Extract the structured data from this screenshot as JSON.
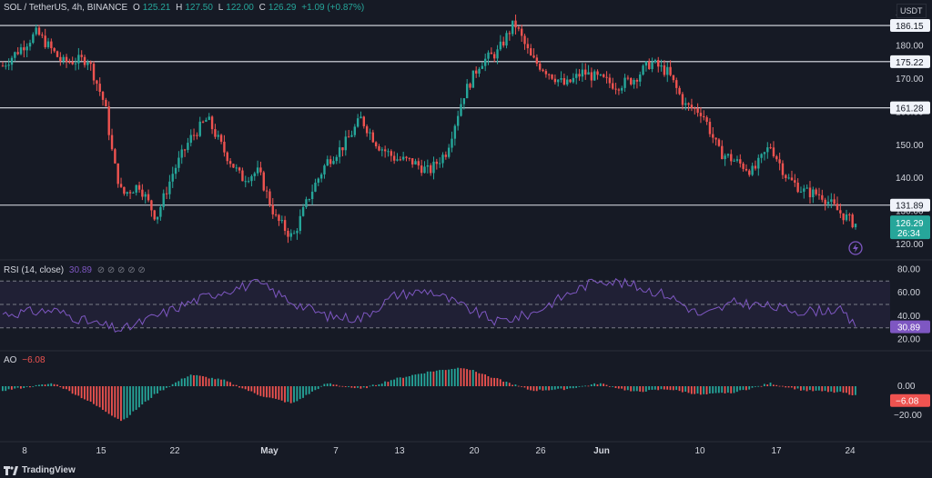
{
  "header": {
    "symbol": "SOL / TetherUS, 4h, BINANCE",
    "open_label": "O",
    "open": "125.21",
    "high_label": "H",
    "high": "127.50",
    "low_label": "L",
    "low": "122.00",
    "close_label": "C",
    "close": "126.29",
    "change": "+1.09 (+0.87%)"
  },
  "currency": "USDT",
  "rsi": {
    "title": "RSI (14, close)",
    "value": "30.89",
    "icons": "⊘ ⊘ ⊘ ⊘ ⊘"
  },
  "ao": {
    "title": "AO",
    "value": "−6.08"
  },
  "footer": {
    "brand": "TradingView"
  },
  "colors": {
    "up": "#26a69a",
    "down": "#ef5350",
    "rsi_line": "#7e57c2",
    "bg": "#161a25",
    "text": "#d1d4dc"
  },
  "chart_data": {
    "type": "candlestick",
    "price_axis_ticks": [
      "190.00",
      "180.00",
      "170.00",
      "160.00",
      "150.00",
      "140.00",
      "130.00",
      "120.00"
    ],
    "price_ylim": [
      117,
      190
    ],
    "horizontal_levels": [
      "186.15",
      "175.22",
      "161.28",
      "131.89"
    ],
    "current_price": "126.29",
    "countdown": "26:34",
    "x_ticks": [
      "8",
      "15",
      "22",
      "May",
      "7",
      "13",
      "20",
      "26",
      "Jun",
      "10",
      "17",
      "24"
    ],
    "rsi_axis_ticks": [
      "80.00",
      "60.00",
      "40.00",
      "20.00"
    ],
    "rsi_levels": [
      70,
      50,
      30
    ],
    "rsi_ylim": [
      15,
      85
    ],
    "rsi_current": "30.89",
    "ao_axis_ticks": [
      "0.00",
      "−20.00"
    ],
    "ao_current": "−6.08",
    "price_keypoints": [
      [
        0,
        174
      ],
      [
        4,
        184
      ],
      [
        7,
        175
      ],
      [
        10,
        176
      ],
      [
        12,
        162
      ],
      [
        13,
        145
      ],
      [
        14,
        135
      ],
      [
        16,
        138
      ],
      [
        18,
        128
      ],
      [
        20,
        142
      ],
      [
        22,
        152
      ],
      [
        24,
        158
      ],
      [
        26,
        148
      ],
      [
        28,
        140
      ],
      [
        30,
        142
      ],
      [
        32,
        128
      ],
      [
        34,
        122
      ],
      [
        36,
        135
      ],
      [
        38,
        145
      ],
      [
        40,
        150
      ],
      [
        42,
        158
      ],
      [
        44,
        150
      ],
      [
        46,
        146
      ],
      [
        48,
        145
      ],
      [
        50,
        142
      ],
      [
        52,
        148
      ],
      [
        54,
        165
      ],
      [
        56,
        175
      ],
      [
        58,
        178
      ],
      [
        60,
        187
      ],
      [
        62,
        176
      ],
      [
        64,
        172
      ],
      [
        66,
        168
      ],
      [
        68,
        172
      ],
      [
        70,
        170
      ],
      [
        72,
        168
      ],
      [
        74,
        170
      ],
      [
        76,
        175
      ],
      [
        78,
        172
      ],
      [
        80,
        162
      ],
      [
        82,
        160
      ],
      [
        84,
        148
      ],
      [
        86,
        145
      ],
      [
        88,
        142
      ],
      [
        90,
        150
      ],
      [
        92,
        140
      ],
      [
        94,
        136
      ],
      [
        96,
        135
      ],
      [
        98,
        130
      ],
      [
        100,
        126
      ]
    ],
    "rsi_keypoints": [
      [
        0,
        42
      ],
      [
        6,
        45
      ],
      [
        10,
        35
      ],
      [
        14,
        28
      ],
      [
        18,
        40
      ],
      [
        22,
        52
      ],
      [
        26,
        62
      ],
      [
        30,
        68
      ],
      [
        34,
        52
      ],
      [
        38,
        40
      ],
      [
        42,
        38
      ],
      [
        46,
        58
      ],
      [
        50,
        62
      ],
      [
        54,
        48
      ],
      [
        58,
        35
      ],
      [
        62,
        42
      ],
      [
        66,
        58
      ],
      [
        70,
        72
      ],
      [
        74,
        66
      ],
      [
        78,
        58
      ],
      [
        82,
        40
      ],
      [
        86,
        52
      ],
      [
        90,
        48
      ],
      [
        94,
        44
      ],
      [
        98,
        46
      ],
      [
        100,
        30.89
      ]
    ],
    "ao_keypoints": [
      [
        0,
        -3
      ],
      [
        6,
        2
      ],
      [
        10,
        -10
      ],
      [
        14,
        -24
      ],
      [
        18,
        -5
      ],
      [
        22,
        8
      ],
      [
        26,
        4
      ],
      [
        30,
        -6
      ],
      [
        34,
        -12
      ],
      [
        38,
        2
      ],
      [
        42,
        -2
      ],
      [
        46,
        5
      ],
      [
        50,
        10
      ],
      [
        54,
        13
      ],
      [
        58,
        5
      ],
      [
        62,
        -3
      ],
      [
        66,
        -2
      ],
      [
        70,
        2
      ],
      [
        74,
        -4
      ],
      [
        78,
        -2
      ],
      [
        82,
        -6
      ],
      [
        86,
        -4
      ],
      [
        90,
        2
      ],
      [
        94,
        -3
      ],
      [
        98,
        -4
      ],
      [
        100,
        -6.08
      ]
    ]
  }
}
